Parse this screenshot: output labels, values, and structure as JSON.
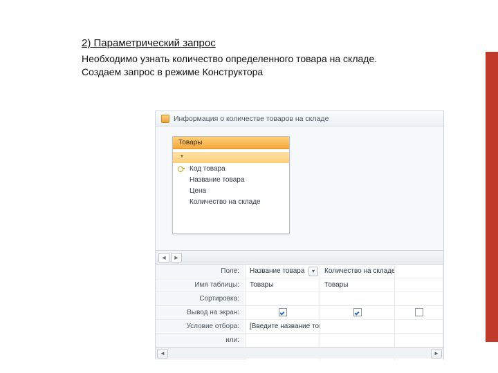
{
  "slide": {
    "heading": "2) Параметрический запрос",
    "line1": "Необходимо узнать количество определенного товара на складе.",
    "line2": "Создаем запрос в режиме Конструктора"
  },
  "access": {
    "tab_title": "Информация о количестве товаров на складе",
    "table": {
      "title": "Товары",
      "star": "*",
      "fields": [
        "Код товара",
        "Название товара",
        "Цена",
        "Количество на складе"
      ]
    },
    "toolbar": {
      "left": "◄",
      "right": "►"
    },
    "grid": {
      "labels": {
        "field": "Поле:",
        "table": "Имя таблицы:",
        "sort": "Сортировка:",
        "show": "Вывод на экран:",
        "criteria": "Условие отбора:",
        "or": "или:"
      },
      "columns": [
        {
          "field": "Название товара",
          "table": "Товары",
          "sort": "",
          "show": true,
          "criteria": "[Введите название това",
          "has_dropdown": true
        },
        {
          "field": "Количество на складе",
          "table": "Товары",
          "sort": "",
          "show": true,
          "criteria": "",
          "has_dropdown": false
        },
        {
          "field": "",
          "table": "",
          "sort": "",
          "show": false,
          "criteria": "",
          "has_dropdown": false
        }
      ],
      "dropdown_glyph": "▾"
    },
    "scroll": {
      "left": "◄",
      "right": "►"
    }
  }
}
